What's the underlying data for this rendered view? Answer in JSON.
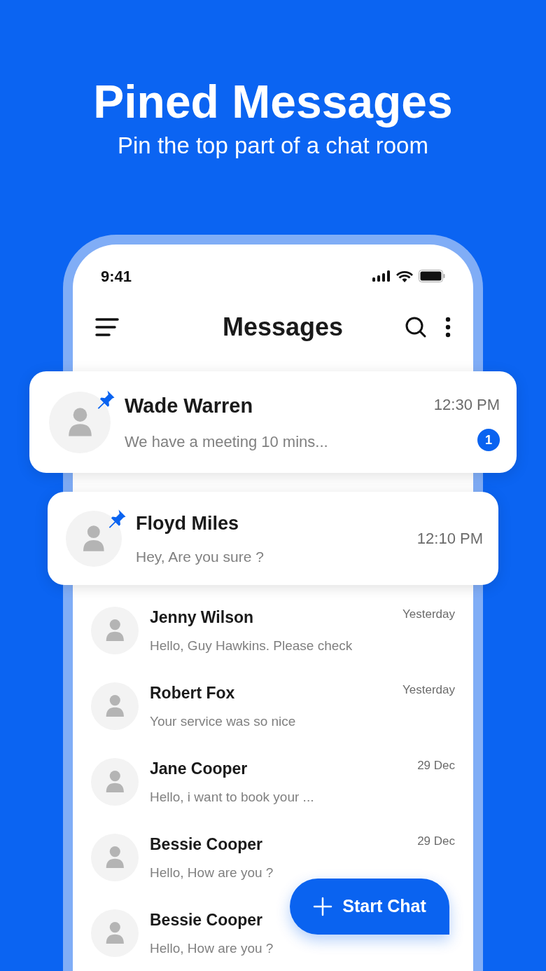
{
  "headline": "Pined Messages",
  "subheadline": "Pin the top part of a chat room",
  "status_bar": {
    "time": "9:41"
  },
  "app_bar": {
    "title": "Messages"
  },
  "pinned_chats": [
    {
      "name": "Wade Warren",
      "preview": "We have a meeting 10 mins...",
      "time": "12:30 PM",
      "unread": "1",
      "pinned": true
    },
    {
      "name": "Floyd Miles",
      "preview": "Hey, Are you sure ?",
      "time": "12:10 PM",
      "pinned": true
    }
  ],
  "chats": [
    {
      "name": "Jenny Wilson",
      "preview": "Hello, Guy Hawkins. Please check",
      "time": "Yesterday"
    },
    {
      "name": "Robert Fox",
      "preview": "Your service was so nice",
      "time": "Yesterday"
    },
    {
      "name": "Jane Cooper",
      "preview": "Hello, i want to book your ...",
      "time": "29 Dec"
    },
    {
      "name": "Bessie Cooper",
      "preview": "Hello, How are you ?",
      "time": "29 Dec"
    },
    {
      "name": "Bessie Cooper",
      "preview": "Hello, How are you ?"
    }
  ],
  "fab": {
    "label": "Start Chat"
  }
}
